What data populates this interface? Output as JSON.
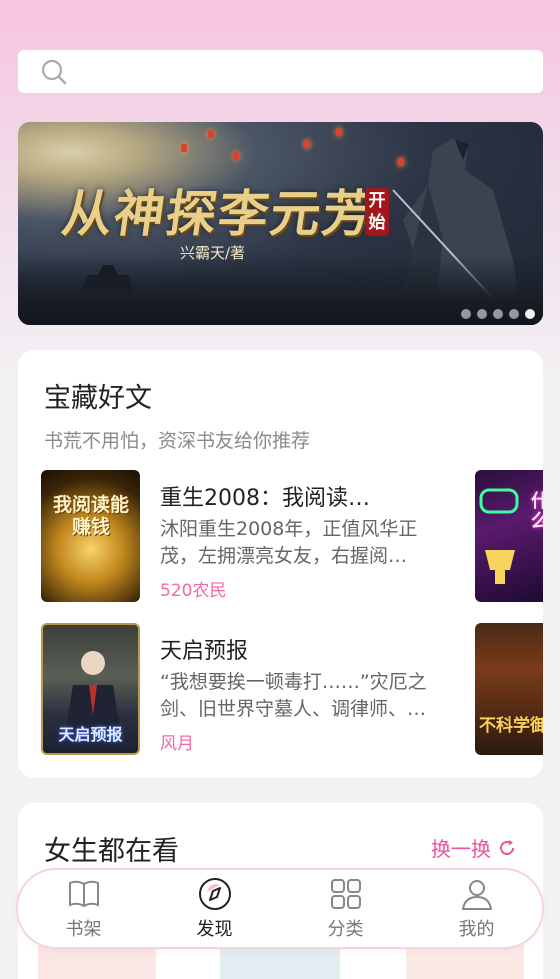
{
  "search": {
    "placeholder": ""
  },
  "banner": {
    "title": "从神探李元芳",
    "seal": "开始",
    "author": "兴霸天/著",
    "slides": 5,
    "active_slide": 4
  },
  "featured": {
    "title": "宝藏好文",
    "subtitle": "书荒不用怕，资深书友给你推荐",
    "books": [
      {
        "name": "重生2008：我阅读…",
        "desc": "沐阳重生2008年，正值风华正茂，左拥漂亮女友，右握阅…",
        "author": "520农民",
        "cover_text": "我阅读能赚钱"
      },
      {
        "name": "天启预报",
        "desc": "“我想要挨一顿毒打……”灾厄之剑、旧世界守墓人、调律师、…",
        "author": "风月",
        "cover_text": "天启预报"
      }
    ],
    "peek_covers": [
      "什么",
      "不科学御"
    ]
  },
  "girls": {
    "title": "女生都在看",
    "refresh_label": "换一换"
  },
  "tabbar": {
    "items": [
      {
        "label": "书架",
        "icon": "book-icon",
        "active": false
      },
      {
        "label": "发现",
        "icon": "compass-icon",
        "active": true
      },
      {
        "label": "分类",
        "icon": "grid-icon",
        "active": false
      },
      {
        "label": "我的",
        "icon": "user-icon",
        "active": false
      }
    ]
  },
  "colors": {
    "accent": "#f0529a",
    "author": "#f06aa3"
  }
}
